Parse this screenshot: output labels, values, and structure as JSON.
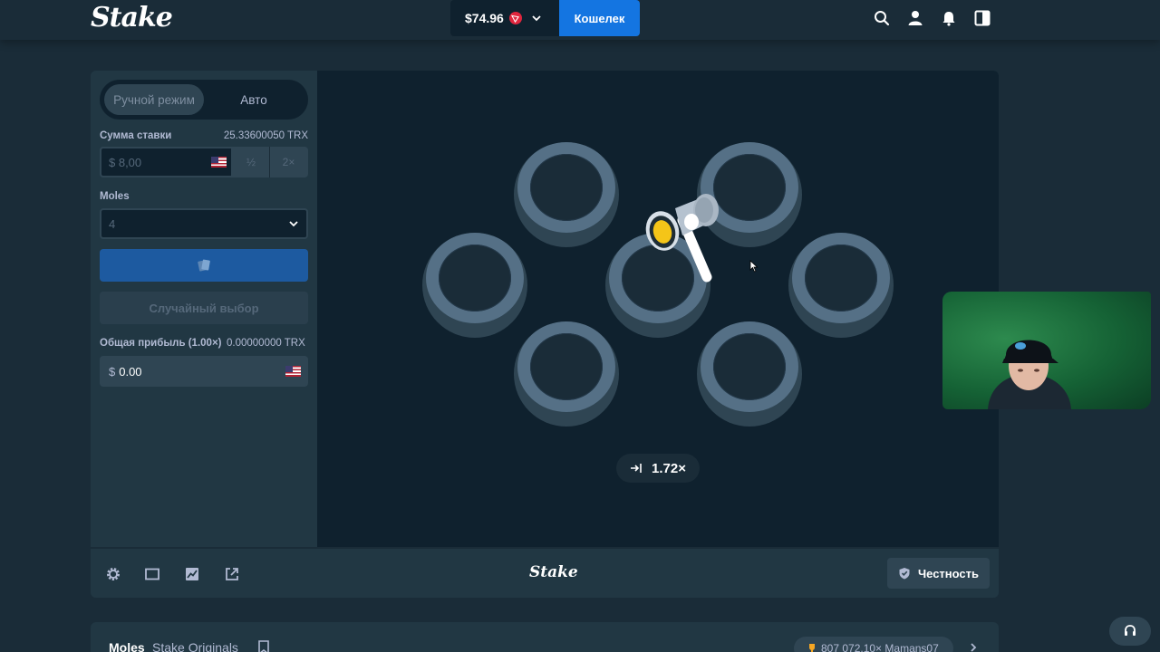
{
  "header": {
    "logo_text": "Stake",
    "balance": "$74.96",
    "currency_icon": "tron-icon",
    "wallet_label": "Кошелек",
    "icons": [
      "search-icon",
      "user-icon",
      "notifications-icon",
      "sidebar-toggle-icon"
    ]
  },
  "sidebar": {
    "mode_tabs": [
      {
        "label": "Ручной режим",
        "active": true
      },
      {
        "label": "Авто",
        "active": false
      }
    ],
    "bet_amount_label": "Сумма ставки",
    "bet_amount_crypto": "25.33600050 TRX",
    "bet_amount_placeholder": "$ 8,00",
    "half_label": "½",
    "double_label": "2×",
    "moles_label": "Moles",
    "moles_value": "4",
    "bet_button_icon": "cards-icon",
    "random_pick_label": "Случайный выбор",
    "total_profit_label": "Общая прибыль (1.00×)",
    "total_profit_crypto": "0.00000000 TRX",
    "total_profit_currency": "$",
    "total_profit_value": "0.00"
  },
  "stage": {
    "multiplier": "1.72×",
    "hole_count": 7
  },
  "footer": {
    "icons": [
      "settings-icon",
      "theatre-mode-icon",
      "stats-icon",
      "popout-icon"
    ],
    "logo_text": "Stake",
    "fairness_label": "Честность"
  },
  "info_bar": {
    "title": "Moles",
    "subtitle": "Stake Originals",
    "record_text": "807 072.10× Mamans07"
  },
  "colors": {
    "background": "#1a2c38",
    "panel": "#213743",
    "stage": "#0f212e",
    "accent_blue": "#1475e1",
    "mole_yellow": "#f5c518"
  }
}
